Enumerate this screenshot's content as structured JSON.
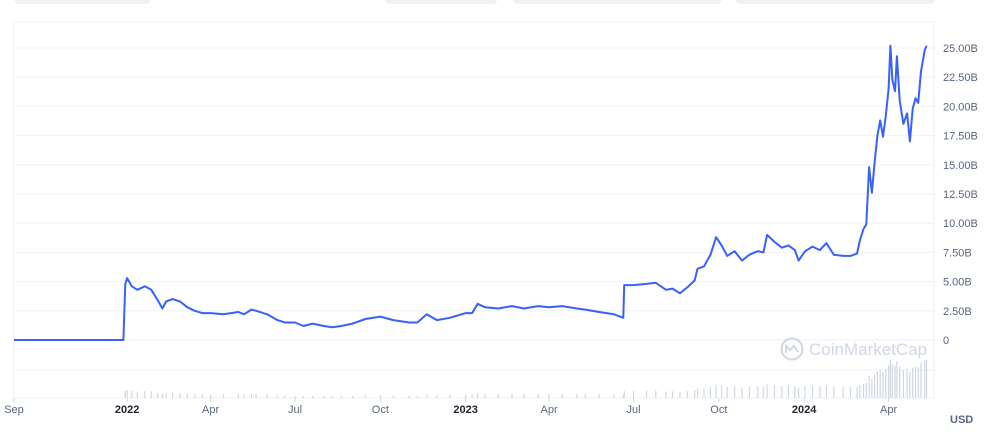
{
  "chart_data": {
    "type": "line",
    "currency": "USD",
    "watermark": "CoinMarketCap",
    "y_ticks": [
      "25.00B",
      "22.50B",
      "20.00B",
      "17.50B",
      "15.00B",
      "12.50B",
      "10.00B",
      "7.50B",
      "5.00B",
      "2.50B",
      "0"
    ],
    "ylim": [
      0,
      26000000000
    ],
    "x_ticks": [
      {
        "label": "Sep",
        "date": "2021-09-01",
        "bold": false
      },
      {
        "label": "2022",
        "date": "2022-01-01",
        "bold": true
      },
      {
        "label": "Apr",
        "date": "2022-04-01",
        "bold": false
      },
      {
        "label": "Jul",
        "date": "2022-07-01",
        "bold": false
      },
      {
        "label": "Oct",
        "date": "2022-10-01",
        "bold": false
      },
      {
        "label": "2023",
        "date": "2023-01-01",
        "bold": true
      },
      {
        "label": "Apr",
        "date": "2023-04-01",
        "bold": false
      },
      {
        "label": "Jul",
        "date": "2023-07-01",
        "bold": false
      },
      {
        "label": "Oct",
        "date": "2023-10-01",
        "bold": false
      },
      {
        "label": "2024",
        "date": "2024-01-01",
        "bold": true
      },
      {
        "label": "Apr",
        "date": "2024-04-01",
        "bold": false
      }
    ],
    "xlim": [
      "2021-09-01",
      "2024-05-20"
    ],
    "grid": true,
    "series": [
      {
        "color": "#3861fb",
        "points": [
          [
            "2021-09-01",
            0
          ],
          [
            "2021-12-28",
            0
          ],
          [
            "2021-12-30",
            4800000000
          ],
          [
            "2022-01-01",
            5300000000
          ],
          [
            "2022-01-06",
            4600000000
          ],
          [
            "2022-01-12",
            4300000000
          ],
          [
            "2022-01-20",
            4600000000
          ],
          [
            "2022-01-27",
            4300000000
          ],
          [
            "2022-02-03",
            3400000000
          ],
          [
            "2022-02-08",
            2700000000
          ],
          [
            "2022-02-12",
            3300000000
          ],
          [
            "2022-02-19",
            3500000000
          ],
          [
            "2022-02-27",
            3300000000
          ],
          [
            "2022-03-07",
            2800000000
          ],
          [
            "2022-03-15",
            2500000000
          ],
          [
            "2022-03-23",
            2300000000
          ],
          [
            "2022-04-01",
            2300000000
          ],
          [
            "2022-04-15",
            2200000000
          ],
          [
            "2022-05-01",
            2400000000
          ],
          [
            "2022-05-07",
            2200000000
          ],
          [
            "2022-05-15",
            2600000000
          ],
          [
            "2022-05-20",
            2500000000
          ],
          [
            "2022-06-01",
            2200000000
          ],
          [
            "2022-06-12",
            1700000000
          ],
          [
            "2022-06-20",
            1500000000
          ],
          [
            "2022-07-01",
            1500000000
          ],
          [
            "2022-07-10",
            1200000000
          ],
          [
            "2022-07-20",
            1400000000
          ],
          [
            "2022-08-01",
            1200000000
          ],
          [
            "2022-08-10",
            1100000000
          ],
          [
            "2022-08-20",
            1200000000
          ],
          [
            "2022-09-01",
            1400000000
          ],
          [
            "2022-09-15",
            1800000000
          ],
          [
            "2022-10-01",
            2000000000
          ],
          [
            "2022-10-15",
            1700000000
          ],
          [
            "2022-11-01",
            1500000000
          ],
          [
            "2022-11-10",
            1500000000
          ],
          [
            "2022-11-20",
            2200000000
          ],
          [
            "2022-12-01",
            1700000000
          ],
          [
            "2022-12-15",
            1900000000
          ],
          [
            "2023-01-01",
            2300000000
          ],
          [
            "2023-01-08",
            2300000000
          ],
          [
            "2023-01-14",
            3100000000
          ],
          [
            "2023-01-22",
            2800000000
          ],
          [
            "2023-02-05",
            2700000000
          ],
          [
            "2023-02-20",
            2900000000
          ],
          [
            "2023-03-05",
            2700000000
          ],
          [
            "2023-03-20",
            2900000000
          ],
          [
            "2023-04-01",
            2800000000
          ],
          [
            "2023-04-15",
            2900000000
          ],
          [
            "2023-05-01",
            2700000000
          ],
          [
            "2023-05-10",
            2600000000
          ],
          [
            "2023-05-25",
            2400000000
          ],
          [
            "2023-06-10",
            2200000000
          ],
          [
            "2023-06-20",
            1900000000
          ],
          [
            "2023-06-21",
            4700000000
          ],
          [
            "2023-07-01",
            4700000000
          ],
          [
            "2023-07-15",
            4800000000
          ],
          [
            "2023-07-25",
            4900000000
          ],
          [
            "2023-08-05",
            4300000000
          ],
          [
            "2023-08-12",
            4400000000
          ],
          [
            "2023-08-20",
            4000000000
          ],
          [
            "2023-08-28",
            4500000000
          ],
          [
            "2023-09-05",
            5100000000
          ],
          [
            "2023-09-08",
            6100000000
          ],
          [
            "2023-09-15",
            6300000000
          ],
          [
            "2023-09-22",
            7300000000
          ],
          [
            "2023-09-28",
            8800000000
          ],
          [
            "2023-10-04",
            8100000000
          ],
          [
            "2023-10-10",
            7200000000
          ],
          [
            "2023-10-18",
            7600000000
          ],
          [
            "2023-10-26",
            6800000000
          ],
          [
            "2023-11-03",
            7300000000
          ],
          [
            "2023-11-12",
            7600000000
          ],
          [
            "2023-11-18",
            7500000000
          ],
          [
            "2023-11-22",
            9000000000
          ],
          [
            "2023-11-30",
            8400000000
          ],
          [
            "2023-12-08",
            7900000000
          ],
          [
            "2023-12-15",
            8100000000
          ],
          [
            "2023-12-22",
            7700000000
          ],
          [
            "2023-12-26",
            6800000000
          ],
          [
            "2024-01-02",
            7600000000
          ],
          [
            "2024-01-10",
            8000000000
          ],
          [
            "2024-01-18",
            7700000000
          ],
          [
            "2024-01-25",
            8300000000
          ],
          [
            "2024-02-02",
            7300000000
          ],
          [
            "2024-02-12",
            7200000000
          ],
          [
            "2024-02-20",
            7200000000
          ],
          [
            "2024-02-27",
            7400000000
          ],
          [
            "2024-03-01",
            8500000000
          ],
          [
            "2024-03-05",
            9500000000
          ],
          [
            "2024-03-08",
            9900000000
          ],
          [
            "2024-03-11",
            14800000000
          ],
          [
            "2024-03-14",
            12600000000
          ],
          [
            "2024-03-17",
            15200000000
          ],
          [
            "2024-03-20",
            17500000000
          ],
          [
            "2024-03-23",
            18800000000
          ],
          [
            "2024-03-26",
            17400000000
          ],
          [
            "2024-03-29",
            19200000000
          ],
          [
            "2024-04-01",
            21500000000
          ],
          [
            "2024-04-03",
            25200000000
          ],
          [
            "2024-04-05",
            22300000000
          ],
          [
            "2024-04-08",
            21300000000
          ],
          [
            "2024-04-10",
            24300000000
          ],
          [
            "2024-04-13",
            20500000000
          ],
          [
            "2024-04-17",
            18500000000
          ],
          [
            "2024-04-21",
            19400000000
          ],
          [
            "2024-04-24",
            17000000000
          ],
          [
            "2024-04-27",
            19800000000
          ],
          [
            "2024-04-30",
            20700000000
          ],
          [
            "2024-05-03",
            20300000000
          ],
          [
            "2024-05-06",
            23000000000
          ],
          [
            "2024-05-10",
            24800000000
          ],
          [
            "2024-05-12",
            25200000000
          ]
        ]
      }
    ]
  }
}
